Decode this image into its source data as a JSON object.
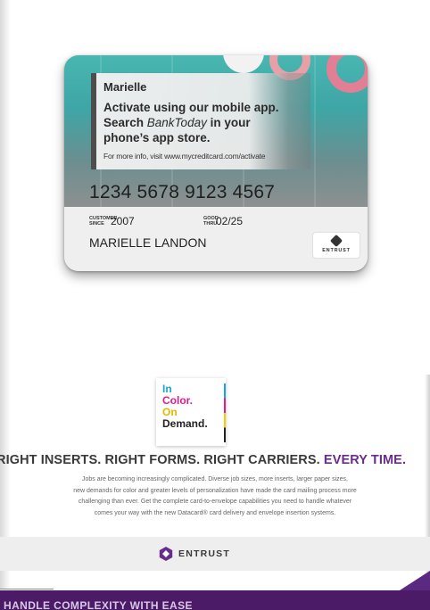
{
  "card": {
    "overlay_name": "Marielle",
    "overlay_line1": "Activate using our mobile app.",
    "overlay_line2_prefix": "Search ",
    "overlay_app_name": "BankToday",
    "overlay_line2_suffix": " in your",
    "overlay_line3": "phone’s app store.",
    "overlay_small": "For more info, visit www.mycreditcard.com/activate",
    "number": "1234 5678 9123 4567",
    "since_label_top": "CUSTOMER",
    "since_label_bottom": "SINCE",
    "since_value": "2007",
    "thru_label_top": "GOOD",
    "thru_label_bottom": "THRU",
    "thru_value": "02/25",
    "holder": "MARIELLE LANDON",
    "logo_text": "ENTRUST"
  },
  "badge": {
    "line1": "In",
    "line2": "Color.",
    "line3": "On",
    "line4": "Demand.",
    "colors": {
      "cyan": "#19a6d6",
      "magenta": "#e01e8b",
      "yellow": "#f0d000",
      "black": "#222222"
    }
  },
  "headline": {
    "main": "RIGHT INSERTS. RIGHT FORMS. RIGHT CARRIERS.",
    "accent": "EVERY TIME."
  },
  "body_copy": [
    "Jobs are becoming increasingly complicated. Diverse job sizes, more inserts, larger paper sizes,",
    "new demands for color and greater levels of personalization have made the card mailing process more",
    "challenging than ever. Get the complete card-to-envelope capabilities you need to handle whatever",
    "comes your way with the new Datacard® card delivery and envelope insertion systems."
  ],
  "brand": {
    "name": "ENTRUST",
    "accent_color": "#6a2c8a"
  },
  "footer": {
    "text": "HANDLE COMPLEXITY WITH EASE"
  },
  "icons": {
    "card_logo": "entrust-diamond-icon",
    "brand_logo": "entrust-hexagon-icon"
  }
}
